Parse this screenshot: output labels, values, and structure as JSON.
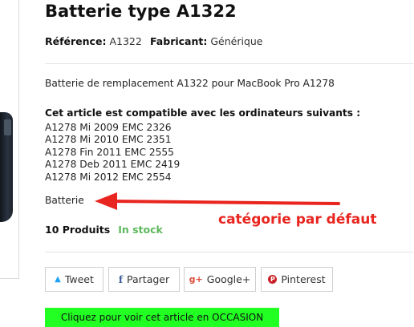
{
  "product": {
    "title": "Batterie type A1322",
    "reference_label": "Référence:",
    "reference_value": "A1322",
    "manufacturer_label": "Fabricant:",
    "manufacturer_value": "Générique"
  },
  "description": "Batterie de remplacement A1322 pour MacBook Pro A1278",
  "compatibility": {
    "heading": "Cet article est compatible avec les ordinateurs suivants :",
    "items": [
      "A1278 Mi 2009 EMC 2326",
      "A1278 Mi 2010 EMC 2351",
      "A1278 Fin 2011 EMC 2555",
      "A1278 Deb 2011 EMC 2419",
      "A1278 Mi 2012 EMC 2554"
    ]
  },
  "category": "Batterie",
  "stock": {
    "count": "10 Produits",
    "status": "In stock",
    "status_color": "#5cb85c"
  },
  "share": {
    "tweet": "Tweet",
    "partager": "Partager",
    "googleplus": "Google+",
    "pinterest": "Pinterest",
    "icons": [
      "twitter-icon",
      "facebook-icon",
      "google-plus-icon",
      "pinterest-icon"
    ]
  },
  "occasion_button": {
    "label": "Cliquez pour voir cet article en OCCASION",
    "color": "#22ff22"
  },
  "annotation": {
    "text": "catégorie par défaut",
    "color": "#e8251f"
  }
}
